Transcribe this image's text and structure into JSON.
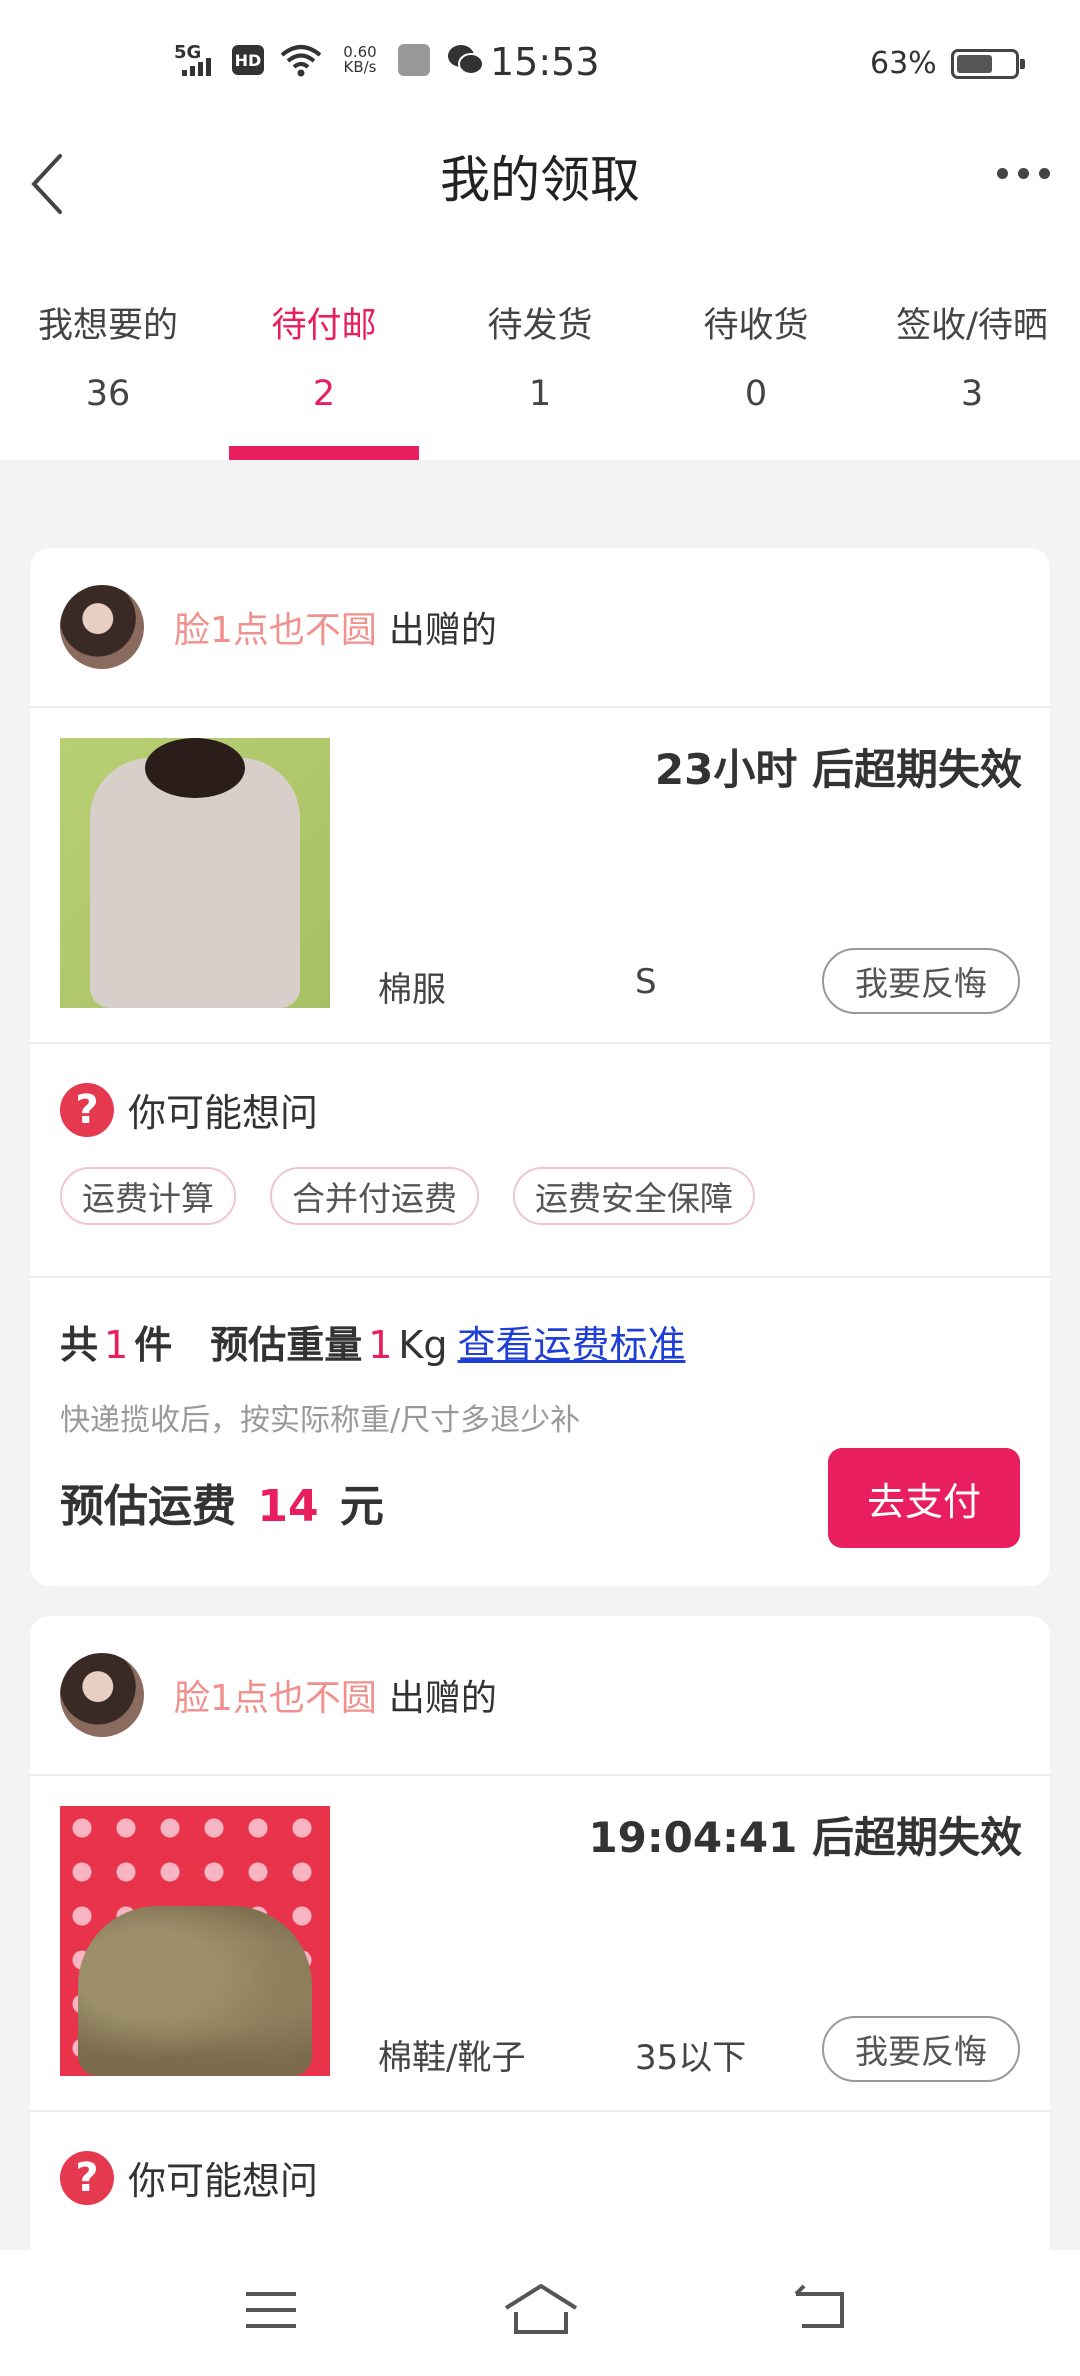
{
  "status_bar": {
    "network": "5G",
    "hd": "HD",
    "speed_value": "0.60",
    "speed_unit": "KB/s",
    "time": "15:53",
    "battery": "63%"
  },
  "header": {
    "title": "我的领取"
  },
  "tabs": [
    {
      "label": "我想要的",
      "count": "36"
    },
    {
      "label": "待付邮",
      "count": "2"
    },
    {
      "label": "待发货",
      "count": "1"
    },
    {
      "label": "待收货",
      "count": "0"
    },
    {
      "label": "签收/待晒",
      "count": "3"
    }
  ],
  "accent_color": "#e91e5e",
  "orders": [
    {
      "giver_name": "脸1点也不圆",
      "giver_suffix": "出赠的",
      "expire": "23小时 后超期失效",
      "category": "棉服",
      "size": "S",
      "regret_label": "我要反悔",
      "faq_title": "你可能想问",
      "faq_chips": [
        "运费计算",
        "合并付运费",
        "运费安全保障"
      ],
      "total_prefix": "共",
      "total_count": "1",
      "total_suffix": "件",
      "weight_label": "预估重量",
      "weight_value": "1",
      "weight_unit": "Kg",
      "standard_link": "查看运费标准",
      "note": "快递揽收后，按实际称重/尺寸多退少补",
      "fee_label": "预估运费",
      "fee_value": "14",
      "fee_unit": "元",
      "pay_label": "去支付"
    },
    {
      "giver_name": "脸1点也不圆",
      "giver_suffix": "出赠的",
      "expire": "19:04:41 后超期失效",
      "category": "棉鞋/靴子",
      "size": "35以下",
      "regret_label": "我要反悔",
      "faq_title": "你可能想问"
    }
  ]
}
